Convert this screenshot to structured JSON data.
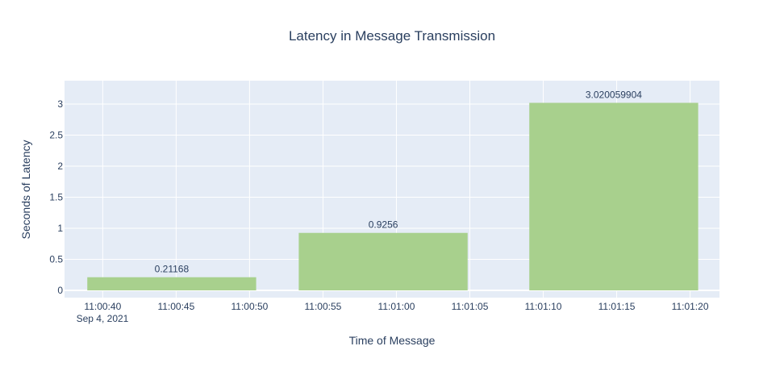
{
  "chart_data": {
    "type": "bar",
    "title": "Latency in Message Transmission",
    "xlabel": "Time of Message",
    "ylabel": "Seconds of Latency",
    "date_label": "Sep 4, 2021",
    "xlim": [
      "11:00:37.4",
      "11:01:22.0"
    ],
    "ylim": [
      -0.117,
      3.377
    ],
    "x_ticks": [
      "11:00:40",
      "11:00:45",
      "11:00:50",
      "11:00:55",
      "11:01:00",
      "11:01:05",
      "11:01:10",
      "11:01:15",
      "11:01:20"
    ],
    "y_ticks": [
      0,
      0.5,
      1,
      1.5,
      2,
      2.5,
      3
    ],
    "bar_width_seconds": 11.5,
    "grid": true,
    "bars": [
      {
        "x": "11:00:44.7",
        "value": 0.21168,
        "label": "0.21168"
      },
      {
        "x": "11:00:59.1",
        "value": 0.9256,
        "label": "0.9256"
      },
      {
        "x": "11:01:14.8",
        "value": 3.020059904,
        "label": "3.020059904"
      }
    ],
    "colors": {
      "bar": "#a8d08d",
      "plot_bg": "#e5ecf6",
      "grid": "#ffffff",
      "text": "#2a3f5f"
    }
  }
}
